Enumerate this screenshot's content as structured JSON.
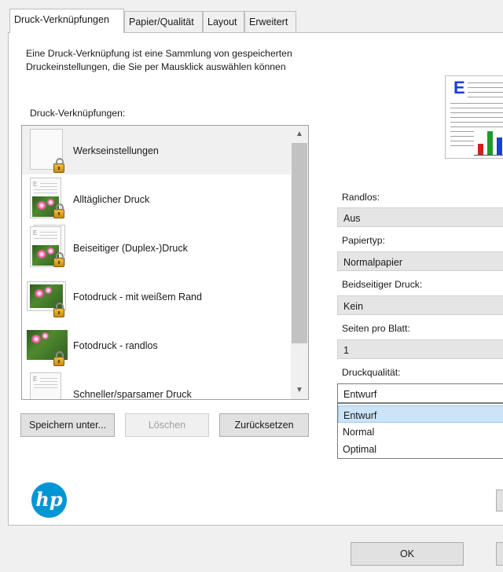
{
  "tabs": [
    {
      "label": "Druck-Verknüpfungen"
    },
    {
      "label": "Papier/Qualität"
    },
    {
      "label": "Layout"
    },
    {
      "label": "Erweitert"
    }
  ],
  "description": "Eine Druck-Verknüpfung ist eine Sammlung von gespeicherten Druckeinstellungen, die Sie per Mausklick auswählen können",
  "shortcuts_label": "Druck-Verknüpfungen:",
  "shortcuts": [
    {
      "title": "Werkseinstellungen"
    },
    {
      "title": "Alltäglicher Druck"
    },
    {
      "title": "Beiseitiger (Duplex-)Druck"
    },
    {
      "title": "Fotodruck - mit weißem Rand"
    },
    {
      "title": "Fotodruck - randlos"
    },
    {
      "title": "Schneller/sparsamer Druck"
    }
  ],
  "buttons": {
    "save_as": "Speichern unter...",
    "delete": "Löschen",
    "reset": "Zurücksetzen",
    "ok": "OK"
  },
  "settings": {
    "borderless": {
      "label": "Randlos:",
      "value": "Aus"
    },
    "paper_type": {
      "label": "Papiertyp:",
      "value": "Normalpapier"
    },
    "duplex": {
      "label": "Beidseitiger Druck:",
      "value": "Kein"
    },
    "pages_per_sheet": {
      "label": "Seiten pro Blatt:",
      "value": "1"
    },
    "quality": {
      "label": "Druckqualität:",
      "value": "Entwurf",
      "options": [
        "Entwurf",
        "Normal",
        "Optimal"
      ],
      "highlighted": "Entwurf"
    }
  },
  "logo": {
    "text": "hp",
    "color": "#0096d6"
  },
  "colors": {
    "accent": "#0096d6",
    "highlight": "#cce4f7"
  }
}
